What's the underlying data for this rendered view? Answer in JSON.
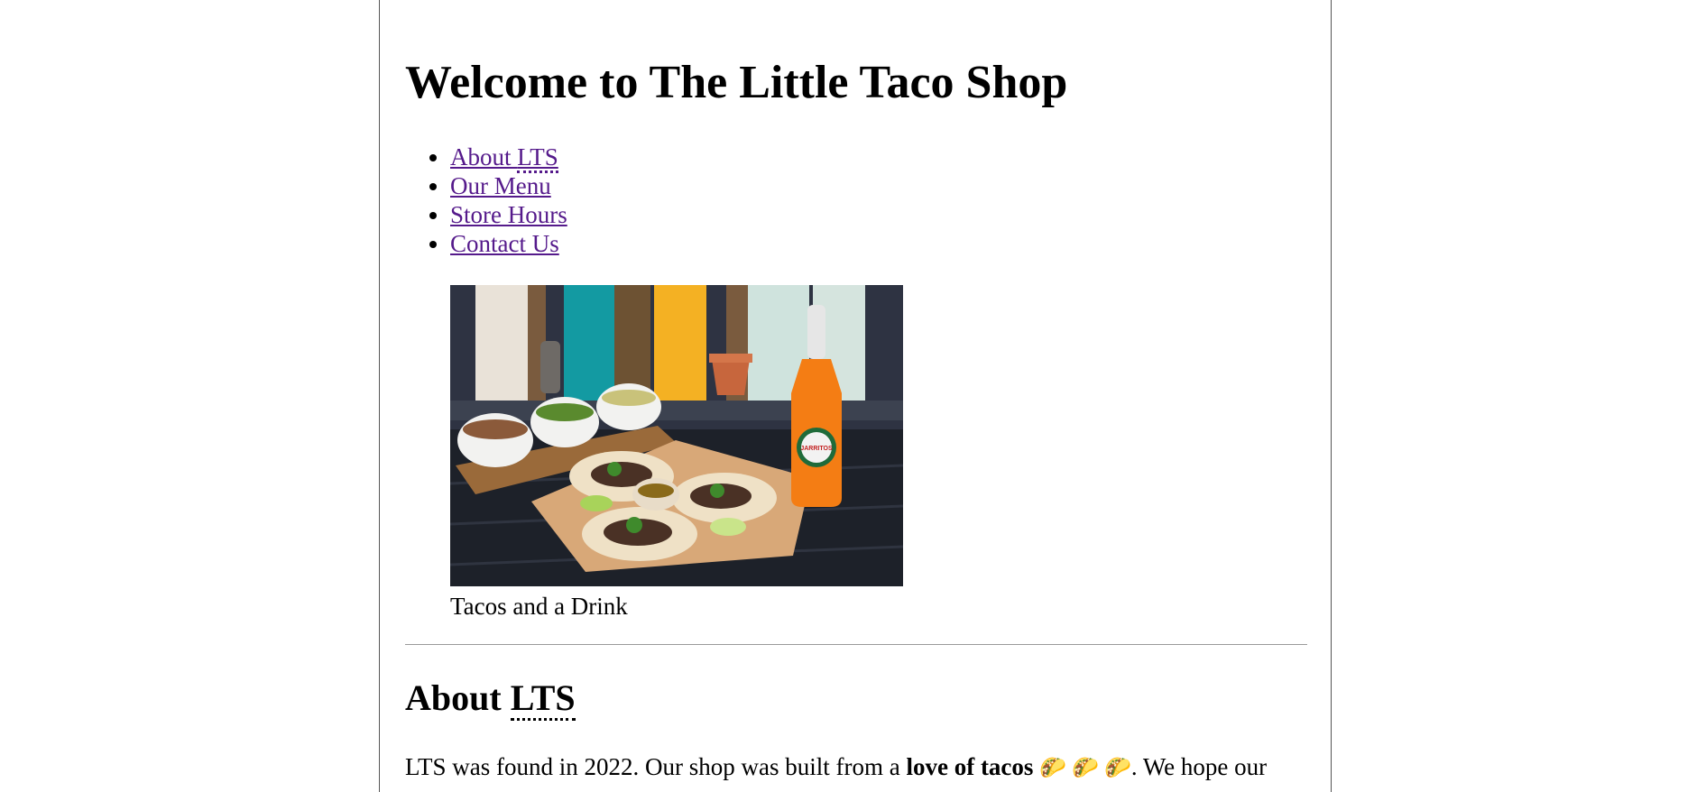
{
  "page": {
    "heading": "Welcome to The Little Taco Shop"
  },
  "nav": {
    "items": [
      {
        "label": "About ",
        "abbr": "LTS"
      },
      {
        "label": "Our Menu"
      },
      {
        "label": "Store Hours"
      },
      {
        "label": "Contact Us"
      }
    ]
  },
  "figure": {
    "caption": "Tacos and a Drink",
    "bottle_label": "JARRITOS"
  },
  "about": {
    "heading": "About ",
    "heading_abbr": "LTS",
    "text_start": "LTS was found in 2022. Our shop was built from a ",
    "text_bold": "love of tacos",
    "emoji": "🌮 🌮 🌮",
    "text_end": ". We hope our"
  },
  "colors": {
    "link_visited": "#551a8b",
    "divider": "#9a9a9a"
  }
}
